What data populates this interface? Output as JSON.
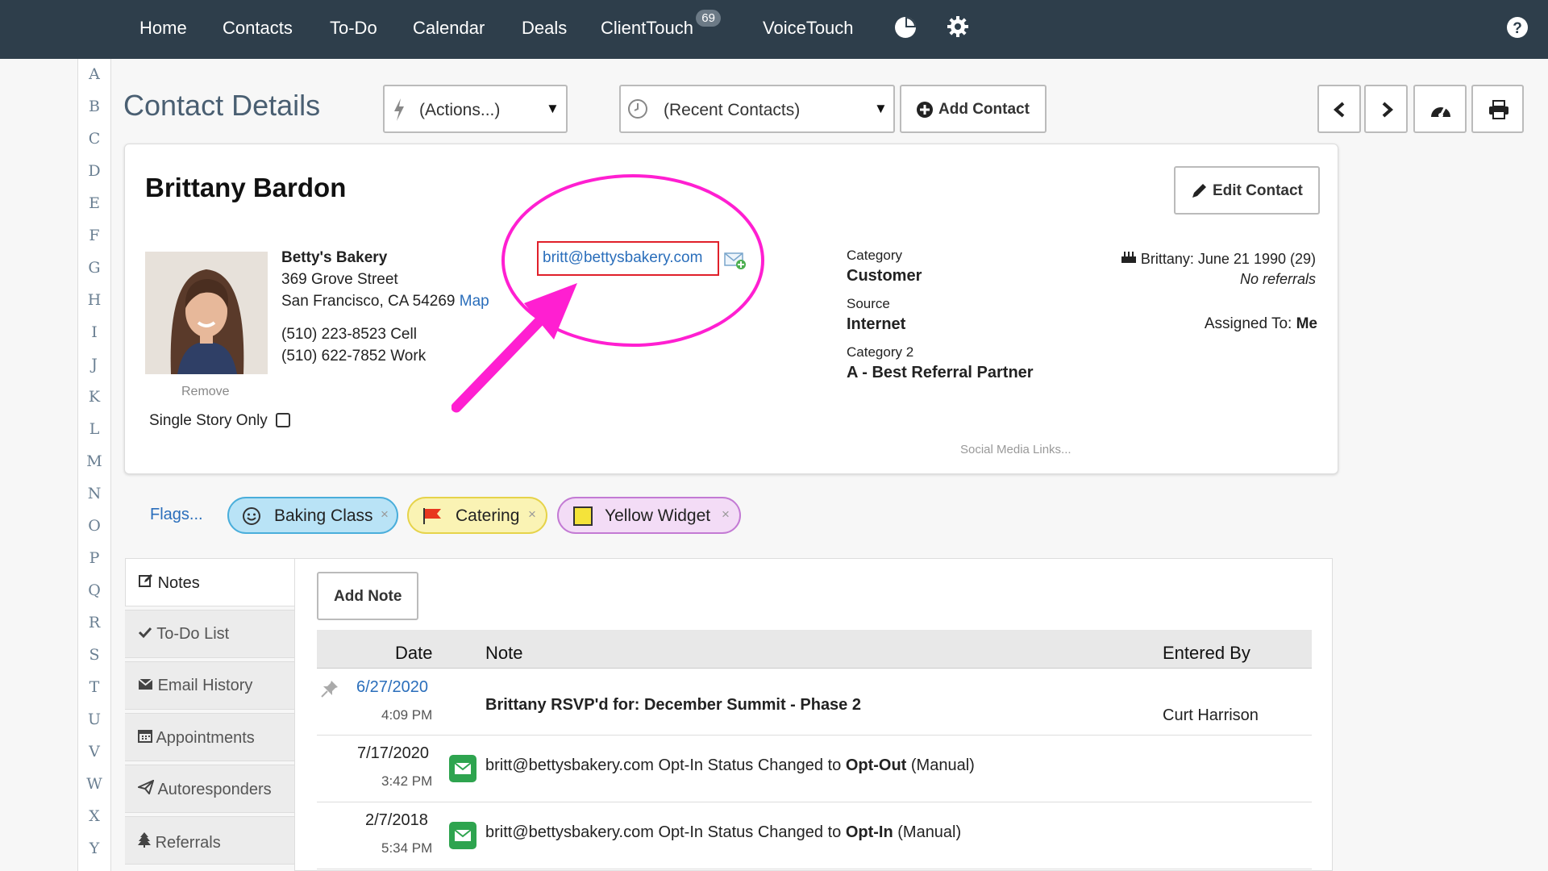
{
  "nav": {
    "items": [
      "Home",
      "Contacts",
      "To-Do",
      "Calendar",
      "Deals",
      "ClientTouch",
      "VoiceTouch"
    ],
    "clienttouch_badge": "69"
  },
  "alphabet": [
    "A",
    "B",
    "C",
    "D",
    "E",
    "F",
    "G",
    "H",
    "I",
    "J",
    "K",
    "L",
    "M",
    "N",
    "O",
    "P",
    "Q",
    "R",
    "S",
    "T",
    "U",
    "V",
    "W",
    "X",
    "Y"
  ],
  "header": {
    "title": "Contact Details",
    "actions_label": "(Actions...)",
    "recent_label": "(Recent Contacts)",
    "add_contact_label": "Add Contact"
  },
  "contact": {
    "name": "Brittany Bardon",
    "edit_label": "Edit Contact",
    "company": "Betty's Bakery",
    "street": "369 Grove Street",
    "city_line": "San Francisco, CA 54269",
    "map_link": "Map",
    "phone_cell": "(510) 223-8523 Cell",
    "phone_work": "(510) 622-7852 Work",
    "email": "britt@bettysbakery.com",
    "remove_label": "Remove",
    "single_story_label": "Single Story Only",
    "category_label": "Category",
    "category_value": "Customer",
    "source_label": "Source",
    "source_value": "Internet",
    "category2_label": "Category 2",
    "category2_value": "A - Best Referral Partner",
    "birthday": "Brittany: June 21 1990 (29)",
    "referrals": "No referrals",
    "assigned_label": "Assigned To:",
    "assigned_value": "Me",
    "social_link": "Social Media Links..."
  },
  "flags": {
    "label": "Flags...",
    "items": [
      {
        "label": "Baking Class",
        "color": "#b9e3f6",
        "border": "#4aaedb"
      },
      {
        "label": "Catering",
        "color": "#faf3b4",
        "border": "#e6d34a"
      },
      {
        "label": "Yellow Widget",
        "color": "#f3dcf6",
        "border": "#c37ad4"
      }
    ]
  },
  "tabs": [
    {
      "label": "Notes",
      "icon": "pencil-square-icon"
    },
    {
      "label": "To-Do List",
      "icon": "check-icon"
    },
    {
      "label": "Email History",
      "icon": "envelope-icon"
    },
    {
      "label": "Appointments",
      "icon": "calendar-icon"
    },
    {
      "label": "Autoresponders",
      "icon": "paper-plane-icon"
    },
    {
      "label": "Referrals",
      "icon": "tree-icon"
    }
  ],
  "notes": {
    "add_label": "Add Note",
    "columns": [
      "Date",
      "Note",
      "Entered By"
    ],
    "rows": [
      {
        "date": "6/27/2020",
        "time": "4:09 PM",
        "note": "Brittany RSVP'd for: December Summit - Phase 2",
        "entered_by": "Curt Harrison"
      },
      {
        "date": "7/17/2020",
        "time": "3:42 PM",
        "note_prefix": "britt@bettysbakery.com Opt-In Status Changed to ",
        "note_bold": "Opt-Out",
        "note_suffix": " (Manual)"
      },
      {
        "date": "2/7/2018",
        "time": "5:34 PM",
        "note_prefix": "britt@bettysbakery.com Opt-In Status Changed to ",
        "note_bold": "Opt-In",
        "note_suffix": " (Manual)"
      }
    ]
  },
  "colors": {
    "nav_bg": "#2e3e4b",
    "link": "#2a6ebb",
    "annotation": "#ff1fd1",
    "email_box": "#e0202a"
  }
}
